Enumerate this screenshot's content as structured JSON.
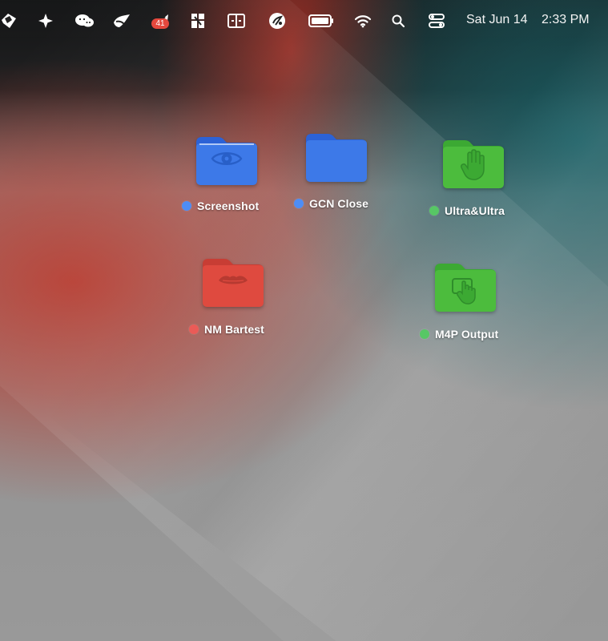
{
  "colors": {
    "blue_folder": "#3d79e8",
    "blue_folder_dark": "#2c62d6",
    "green_folder": "#4cbc3d",
    "green_folder_dark": "#3ca933",
    "red_folder": "#df4a3f",
    "red_folder_dark": "#c83d34",
    "blue_tag": "#4d8df5",
    "green_tag": "#57c765",
    "red_tag": "#ea5b57",
    "badge": "#e5483d"
  },
  "menubar": {
    "badge_count": "41",
    "date": "Sat Jun 14",
    "time": "2:33 PM",
    "icons": [
      "app-logo-icon",
      "sparkle-icon",
      "wechat-icon",
      "bird-app-icon",
      "notification-app-icon",
      "grid-app-icon",
      "split-view-icon",
      "scooter-app-icon",
      "battery-icon",
      "wifi-icon",
      "search-icon",
      "control-center-icon"
    ]
  },
  "desktop": {
    "items": [
      {
        "name": "Screenshot",
        "color": "blue",
        "icon": "eye-icon"
      },
      {
        "name": "GCN Close",
        "color": "blue",
        "icon": "plain-folder-icon"
      },
      {
        "name": "Ultra&Ultra",
        "color": "green",
        "icon": "hand-icon"
      },
      {
        "name": "NM Bartest",
        "color": "red",
        "icon": "lips-icon"
      },
      {
        "name": "M4P Output",
        "color": "green",
        "icon": "touch-hand-icon"
      }
    ]
  }
}
